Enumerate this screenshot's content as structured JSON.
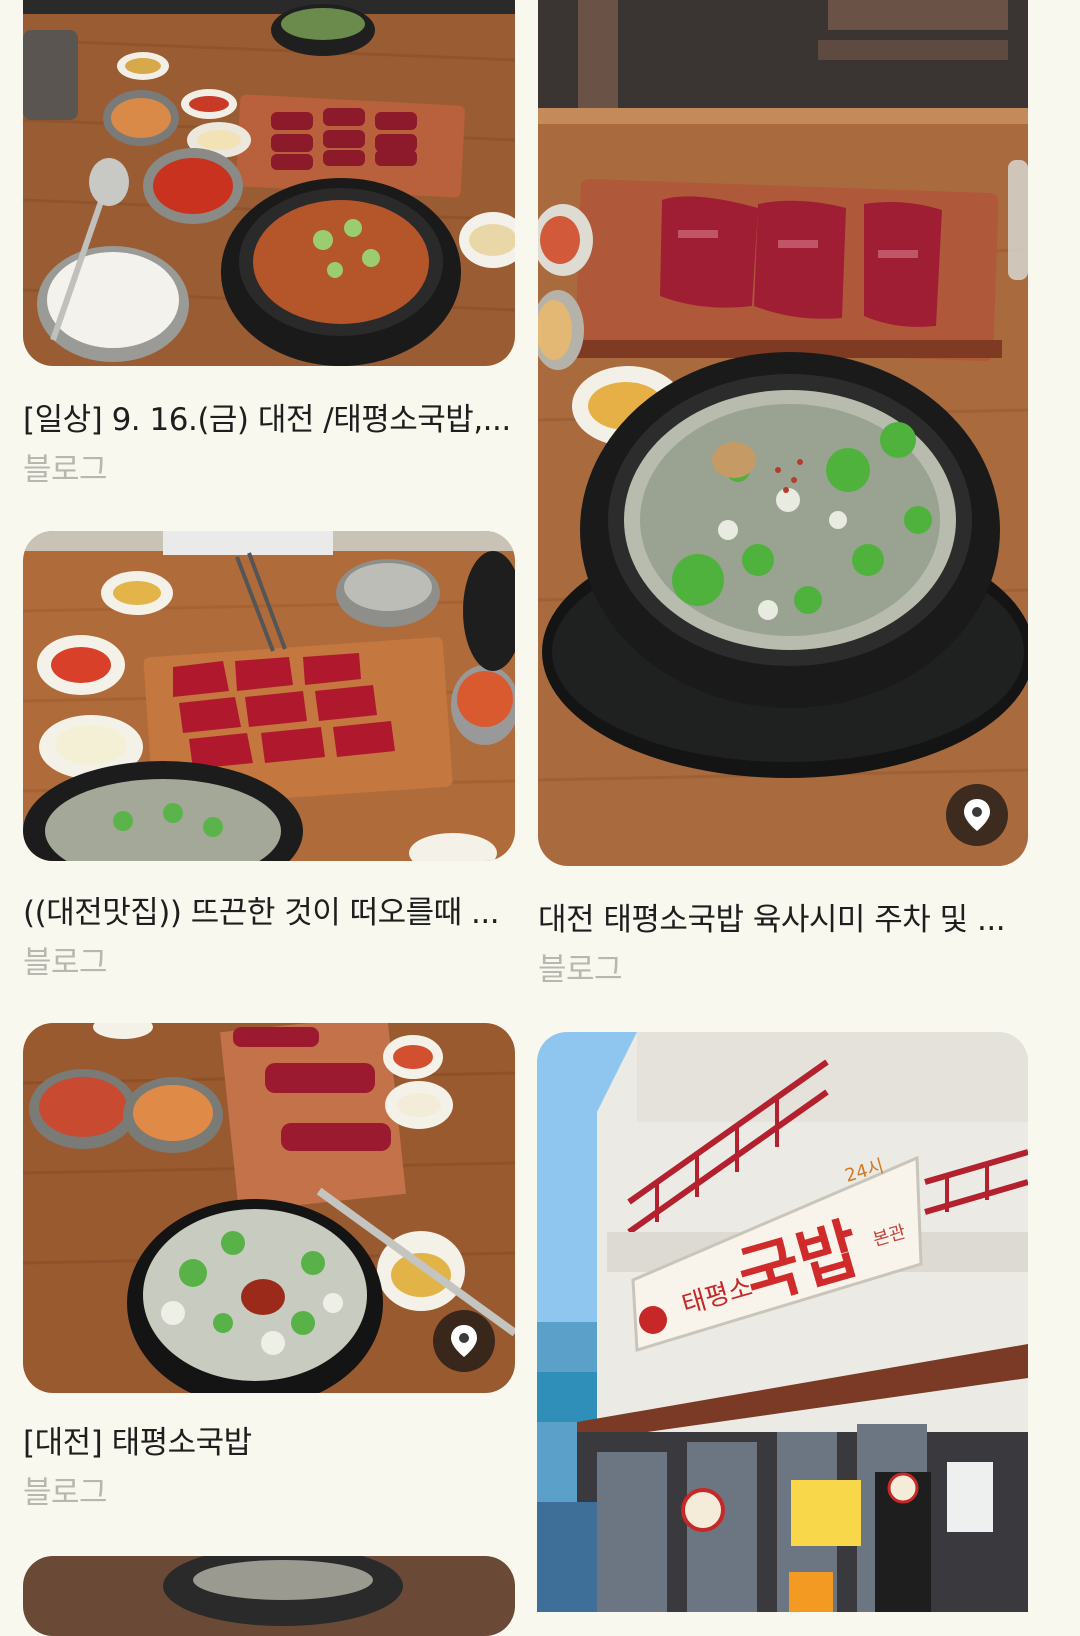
{
  "cards": [
    {
      "title": "[일상] 9. 16.(금) 대전 /태평소국밥,...",
      "source": "블로그",
      "image": "soup-and-raw-beef-table-photo"
    },
    {
      "title": "대전 태평소국밥 육사시미 주차 및 ...",
      "source": "블로그",
      "image": "clear-soup-bowl-and-beef-platter-photo",
      "badge_icon": "location-pin-icon"
    },
    {
      "title": "((대전맛집)) 뜨끈한 것이 떠오를때 ...",
      "source": "블로그",
      "image": "beef-sashimi-board-photo"
    },
    {
      "title": "[대전] 태평소국밥",
      "source": "블로그",
      "image": "soup-with-chili-and-beef-photo",
      "badge_icon": "location-pin-icon"
    },
    {
      "title": "",
      "source": "",
      "image": "restaurant-storefront-photo"
    }
  ],
  "storefront_sign": {
    "hours": "24시",
    "name_small": "태평소",
    "name_big": "국밥",
    "branch": "본관"
  },
  "colors": {
    "background": "#f8f8ef",
    "title_text": "#1e1e1e",
    "source_text": "#b7b7b0"
  }
}
